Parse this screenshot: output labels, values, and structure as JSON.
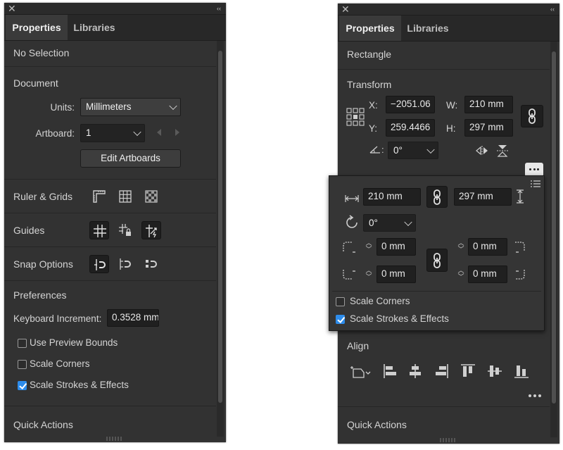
{
  "left_panel": {
    "tabs": [
      {
        "label": "Properties"
      },
      {
        "label": "Libraries"
      }
    ],
    "selection_title": "No Selection",
    "document": {
      "title": "Document",
      "units_label": "Units:",
      "units_value": "Millimeters",
      "artboard_label": "Artboard:",
      "artboard_value": "1",
      "edit_artboards": "Edit Artboards"
    },
    "ruler_grids_title": "Ruler & Grids",
    "guides_title": "Guides",
    "snap_options_title": "Snap Options",
    "preferences": {
      "title": "Preferences",
      "keyboard_increment_label": "Keyboard Increment:",
      "keyboard_increment_value": "0.3528 mm",
      "use_preview_bounds": "Use Preview Bounds",
      "scale_corners": "Scale Corners",
      "scale_strokes_effects": "Scale Strokes & Effects"
    },
    "quick_actions_title": "Quick Actions"
  },
  "right_panel": {
    "tabs": [
      {
        "label": "Properties"
      },
      {
        "label": "Libraries"
      }
    ],
    "selection_title": "Rectangle",
    "transform": {
      "title": "Transform",
      "x_label": "X:",
      "x_value": "−2051.06",
      "y_label": "Y:",
      "y_value": "259.4466",
      "w_label": "W:",
      "w_value": "210 mm",
      "h_label": "H:",
      "h_value": "297 mm",
      "angle_value": "0°"
    },
    "flyout": {
      "width_value": "210 mm",
      "height_value": "297 mm",
      "rotate_value": "0°",
      "corner_tl": "0 mm",
      "corner_tr": "0 mm",
      "corner_bl": "0 mm",
      "corner_br": "0 mm",
      "scale_corners": "Scale Corners",
      "scale_strokes_effects": "Scale Strokes & Effects"
    },
    "align_title": "Align",
    "quick_actions_title": "Quick Actions"
  },
  "checkbox_state": {
    "use_preview_bounds": false,
    "scale_corners_left": false,
    "scale_strokes_left": true,
    "scale_corners_flyout": false,
    "scale_strokes_flyout": true
  },
  "colors": {
    "panel_bg": "#323232",
    "accent": "#2d8ceb"
  }
}
